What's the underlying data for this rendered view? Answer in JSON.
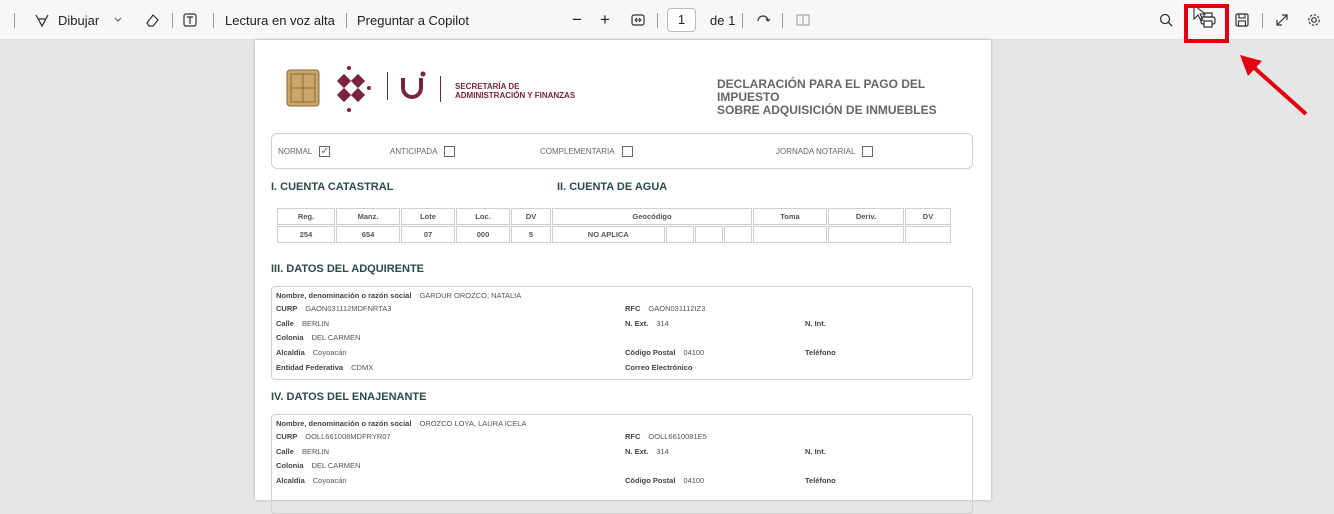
{
  "toolbar": {
    "draw_label": "Dibujar",
    "read_aloud": "Lectura en voz alta",
    "ask_copilot": "Preguntar a Copilot",
    "zoom_out": "−",
    "zoom_in": "+",
    "page_current": "1",
    "page_of": "de 1"
  },
  "header": {
    "secretaria_line1": "SECRETARÍA DE",
    "secretaria_line2": "ADMINISTRACIÓN Y FINANZAS",
    "title_line1": "DECLARACIÓN PARA EL PAGO DEL IMPUESTO",
    "title_line2": "SOBRE ADQUISICIÓN DE INMUEBLES"
  },
  "options": {
    "normal": "NORMAL",
    "anticipada": "ANTICIPADA",
    "complementaria": "COMPLEMENTARIA",
    "jornada": "JORNADA NOTARIAL",
    "normal_checked": true
  },
  "sections": {
    "cuenta_catastral": "I. CUENTA CATASTRAL",
    "cuenta_agua": "II. CUENTA DE AGUA",
    "adquirente": "III. DATOS DEL ADQUIRENTE",
    "enajenante": "IV. DATOS DEL ENAJENANTE"
  },
  "catastral": {
    "headers": [
      "Reg.",
      "Manz.",
      "Lote",
      "Loc.",
      "DV"
    ],
    "values": [
      "254",
      "654",
      "07",
      "000",
      "5"
    ]
  },
  "agua": {
    "headers": [
      "Geocódigo",
      "Toma",
      "Deriv.",
      "DV"
    ],
    "geocodigo": "NO APLICA"
  },
  "labels": {
    "nombre": "Nombre, denominación o razón social",
    "curp": "CURP",
    "calle": "Calle",
    "colonia": "Colonia",
    "alcaldia": "Alcaldía",
    "entidad": "Entidad Federativa",
    "rfc": "RFC",
    "next": "N. Ext.",
    "nint": "N. Int.",
    "cp": "Código Postal",
    "telefono": "Teléfono",
    "correo": "Correo Electrónico"
  },
  "adquirente": {
    "nombre": "GARDUR OROZCO, NATALIA",
    "curp": "GAON031112MDFNRTA3",
    "calle": "BERLIN",
    "colonia": "DEL CARMEN",
    "alcaldia": "Coyoacán",
    "entidad": "CDMX",
    "rfc": "GAON031112IZ3",
    "next": "314",
    "cp": "04100"
  },
  "enajenante": {
    "nombre": "OROZCO LOYA, LAURA ICELA",
    "curp": "OOLL661008MDFRYR07",
    "calle": "BERLIN",
    "colonia": "DEL CARMEN",
    "alcaldia": "Coyoacán",
    "rfc": "OOLL6610081E5",
    "next": "314",
    "cp": "04100"
  },
  "colors": {
    "highlight": "#e3000f",
    "brand": "#7b2241",
    "heading": "#2b4a4a"
  }
}
